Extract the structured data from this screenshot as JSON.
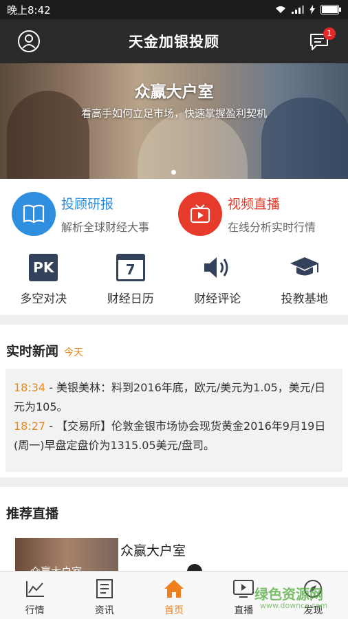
{
  "status_bar": {
    "time": "晚上8:42"
  },
  "app_bar": {
    "title": "天金加银投顾",
    "message_badge": "1"
  },
  "banner": {
    "title": "众赢大户室",
    "subtitle": "看高手如何立足市场，快速掌握盈利契机"
  },
  "features": [
    {
      "title": "投顾研报",
      "subtitle": "解析全球财经大事",
      "color": "#2e8fe0",
      "icon": "book-icon"
    },
    {
      "title": "视频直播",
      "subtitle": "在线分析实时行情",
      "color": "#e63a2a",
      "icon": "tv-play-icon"
    }
  ],
  "grid": [
    {
      "label": "多空对决",
      "icon": "pk-icon",
      "glyph": "PK"
    },
    {
      "label": "财经日历",
      "icon": "calendar-icon",
      "glyph": "7"
    },
    {
      "label": "财经评论",
      "icon": "speaker-icon"
    },
    {
      "label": "投教基地",
      "icon": "graduation-cap-icon"
    }
  ],
  "news": {
    "heading": "实时新闻",
    "today": "今天",
    "items": [
      {
        "time": "18:34",
        "text": " - 美银美林：料到2016年底，欧元/美元为1.05，美元/日元为105。"
      },
      {
        "time": "18:27",
        "text": " - 【交易所】伦敦金银市场协会现货黄金2016年9月19日(周一)早盘定盘价为1315.05美元/盘司。"
      }
    ]
  },
  "recommend": {
    "heading": "推荐直播",
    "item_title": "众赢大户室",
    "thumb_text": "众赢大户室"
  },
  "tabs": [
    {
      "label": "行情",
      "icon": "chart-line-icon"
    },
    {
      "label": "资讯",
      "icon": "document-icon"
    },
    {
      "label": "首页",
      "icon": "home-icon",
      "active": true
    },
    {
      "label": "直播",
      "icon": "video-play-icon"
    },
    {
      "label": "发现",
      "icon": "compass-icon"
    }
  ],
  "watermark": {
    "text": "绿色资源网",
    "url_text": "www.downcc.com"
  },
  "colors": {
    "accent": "#f07f1d",
    "blue": "#2e8fe0",
    "red": "#e63a2a",
    "icon_navy": "#34415a"
  }
}
